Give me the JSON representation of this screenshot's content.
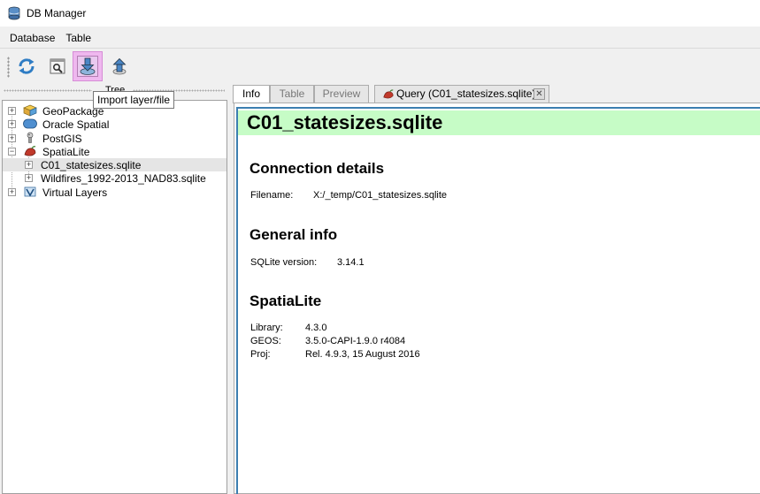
{
  "window": {
    "title": "DB Manager"
  },
  "menu": [
    "Database",
    "Table"
  ],
  "toolbar": {
    "buttons": [
      {
        "name": "refresh",
        "icon": "refresh-icon"
      },
      {
        "name": "sql-window",
        "icon": "sql-window-icon"
      },
      {
        "name": "import-layer",
        "icon": "import-icon",
        "active": true
      },
      {
        "name": "export-file",
        "icon": "export-icon"
      }
    ],
    "tooltip": "Import layer/file"
  },
  "tree": {
    "header_title": "Tree",
    "items": [
      {
        "label": "GeoPackage",
        "icon": "geopackage-icon"
      },
      {
        "label": "Oracle Spatial",
        "icon": "oracle-icon"
      },
      {
        "label": "PostGIS",
        "icon": "postgis-icon"
      },
      {
        "label": "SpatiaLite",
        "icon": "spatialite-icon"
      },
      {
        "label": "C01_statesizes.sqlite",
        "selected": true
      },
      {
        "label": "Wildfires_1992-2013_NAD83.sqlite"
      },
      {
        "label": "Virtual Layers",
        "icon": "virtual-layers-icon"
      }
    ]
  },
  "tabs": [
    {
      "label": "Info",
      "active": true
    },
    {
      "label": "Table"
    },
    {
      "label": "Preview"
    },
    {
      "label": "Query (C01_statesizes.sqlite)",
      "icon": "query-icon",
      "closable": true
    }
  ],
  "info": {
    "title": "C01_statesizes.sqlite",
    "connection": {
      "heading": "Connection details",
      "filename_label": "Filename:",
      "filename_value": "X:/_temp/C01_statesizes.sqlite"
    },
    "general": {
      "heading": "General info",
      "version_label": "SQLite version:",
      "version_value": "3.14.1"
    },
    "spatialite": {
      "heading": "SpatiaLite",
      "library_label": "Library:",
      "library_value": "4.3.0",
      "geos_label": "GEOS:",
      "geos_value": "3.5.0-CAPI-1.9.0 r4084",
      "proj_label": "Proj:",
      "proj_value": "Rel. 4.9.3, 15 August 2016"
    }
  },
  "colors": {
    "title_bg": "#c6fcc6",
    "accent_border": "#3c7fb1",
    "active_button": "#efb8ef"
  }
}
